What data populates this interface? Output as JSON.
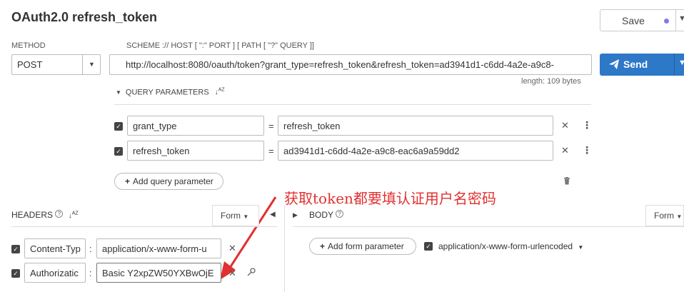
{
  "request": {
    "title": "OAuth2.0 refresh_token",
    "save_label": "Save",
    "send_label": "Send",
    "method_label": "METHOD",
    "method_value": "POST",
    "scheme_label": "SCHEME :// HOST [ \":\" PORT ] [ PATH [ \"?\" QUERY ]]",
    "url": "http://localhost:8080/oauth/token?grant_type=refresh_token&refresh_token=ad3941d1-c6dd-4a2e-a9c8-",
    "length_text": "length: 109 bytes"
  },
  "query": {
    "header": "QUERY PARAMETERS",
    "sort_icon": "sort-icon",
    "params": [
      {
        "name": "grant_type",
        "value": "refresh_token"
      },
      {
        "name": "refresh_token",
        "value": "ad3941d1-c6dd-4a2e-a9c8-eac6a9a59dd2"
      }
    ],
    "add_label": "Add query parameter"
  },
  "annotation": "获取token都要填认证用户名密码",
  "headers": {
    "title": "HEADERS",
    "form_label": "Form",
    "items": [
      {
        "name": "Content-Typ",
        "value": "application/x-www-form-u"
      },
      {
        "name": "Authorizatic",
        "value": "Basic Y2xpZW50YXBwOjE"
      }
    ]
  },
  "body": {
    "title": "BODY",
    "form_label": "Form",
    "add_label": "Add form parameter",
    "encoding": "application/x-www-form-urlencoded"
  },
  "colors": {
    "send": "#2e78c8",
    "annotation": "#e23030",
    "save_dot": "#7e7ee6"
  }
}
